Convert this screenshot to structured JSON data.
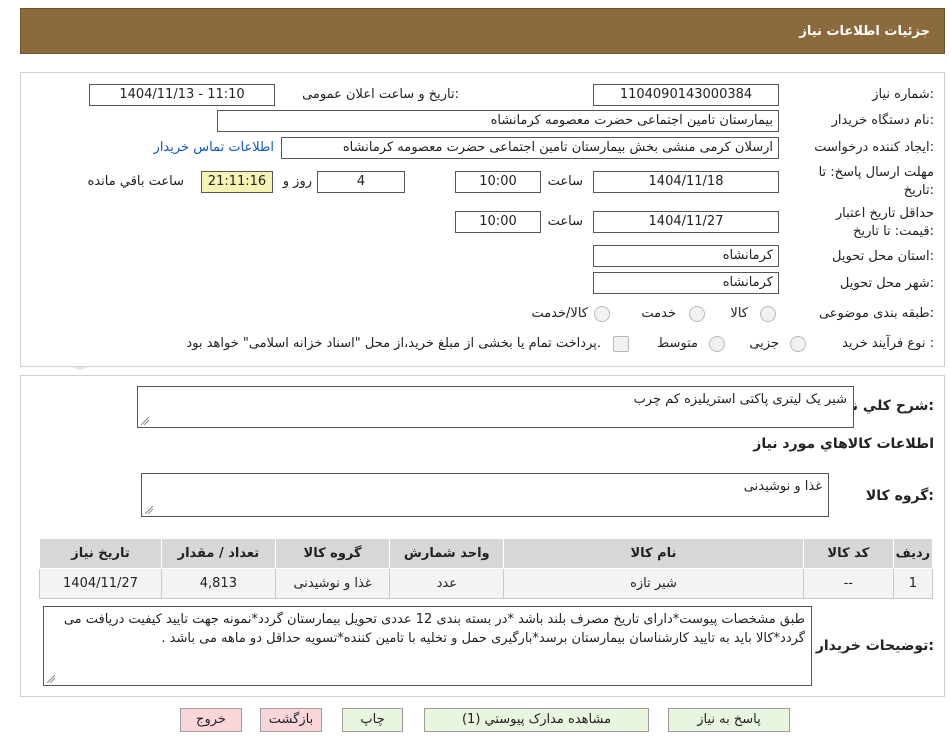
{
  "header": {
    "title": "جزئیات اطلاعات نیاز"
  },
  "watermark": {
    "text": "AriaTender.neT"
  },
  "form": {
    "need_number": {
      "label": "شماره نیاز:",
      "value": "1104090143000384"
    },
    "announce_datetime": {
      "label": "تاریخ و ساعت اعلان عمومی:",
      "value": "1404/11/13 - 11:10"
    },
    "buyer_org": {
      "label": "نام دستگاه خریدار:",
      "value": "بیمارستان تامین اجتماعی حضرت معصومه کرمانشاه"
    },
    "creator": {
      "label": "ایجاد کننده درخواست:",
      "value": "ارسلان کرمی منشی بخش  بیمارستان تامین اجتماعی حضرت معصومه کرمانشاه",
      "contact_link": "اطلاعات تماس خریدار"
    },
    "response_deadline": {
      "label_line1": "مهلت ارسال پاسخ: تا",
      "label_line2": "تاریخ:",
      "date": "1404/11/18",
      "time_label": "ساعت",
      "time": "10:00",
      "days": "4",
      "days_label": "روز و",
      "remaining": "21:11:16",
      "remaining_label": "ساعت باقي مانده"
    },
    "price_validity": {
      "label_line1": "حداقل تاریخ اعتبار",
      "label_line2": "قیمت: تا تاریخ:",
      "date": "1404/11/27",
      "time_label": "ساعت",
      "time": "10:00"
    },
    "delivery_province": {
      "label": "استان محل تحویل:",
      "value": "کرمانشاه"
    },
    "delivery_city": {
      "label": "شهر محل تحویل:",
      "value": "کرمانشاه"
    },
    "category": {
      "label": "طبقه بندی موضوعی:",
      "options": [
        "کالا",
        "خدمت",
        "کالا/خدمت"
      ]
    },
    "process_type": {
      "label": "نوع فرآیند خرید :",
      "options": [
        "جزیی",
        "متوسط"
      ],
      "checkbox_text": "پرداخت تمام یا بخشی از مبلغ خرید،از محل \"اسناد خزانه اسلامی\" خواهد بود."
    }
  },
  "need": {
    "summary_label": "شرح کلي نياز:",
    "summary_value": "شیر یک لیتری پاکتی استریلیزه کم چرب",
    "goods_info_title": "اطلاعات کالاهاي مورد نياز",
    "goods_group_label": "گروه کالا:",
    "goods_group_value": "غذا و نوشیدنی",
    "table": {
      "headers": [
        "رديف",
        "کد کالا",
        "نام کالا",
        "واحد شمارش",
        "گروه کالا",
        "تعداد / مقدار",
        "تاريخ نياز"
      ],
      "rows": [
        [
          "1",
          "--",
          "شیر تازه",
          "عدد",
          "غذا و نوشیدنی",
          "4,813",
          "1404/11/27"
        ]
      ]
    },
    "buyer_notes_label": "توضيحات خريدار:",
    "buyer_notes_value": "طبق مشخصات پیوست*دارای تاریخ مصرف بلند باشد *در بسته بندی 12 عددی تحویل بیمارستان گردد*نمونه جهت تایید کیفیت دریافت می گردد*کالا باید به تایید کارشناسان بیمارستان برسد*بارگیری حمل و تخلیه با تامین کننده*تسویه حداقل دو ماهه می باشد ."
  },
  "buttons": {
    "reply": "پاسخ به نياز",
    "attachments": "مشاهده مدارک پيوستي (1)",
    "print": "چاپ",
    "back": "بازگشت",
    "exit": "خروج"
  }
}
